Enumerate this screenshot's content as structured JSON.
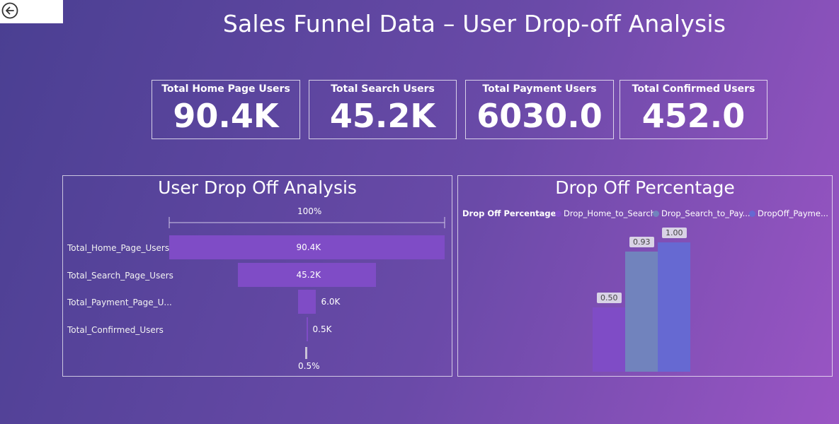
{
  "page": {
    "title": "Sales Funnel Data – User Drop-off Analysis"
  },
  "kpis": [
    {
      "label": "Total Home Page Users",
      "value": "90.4K"
    },
    {
      "label": "Total Search Users",
      "value": "45.2K"
    },
    {
      "label": "Total Payment Users",
      "value": "6030.0"
    },
    {
      "label": "Total Confirmed Users",
      "value": "452.0"
    }
  ],
  "chart_data": [
    {
      "type": "bar",
      "subtype": "funnel",
      "title": "User Drop Off Analysis",
      "top_label": "100%",
      "bottom_label": "0.5%",
      "categories": [
        "Total_Home_Page_Users",
        "Total_Search_Page_Users",
        "Total_Payment_Page_U...",
        "Total_Confirmed_Users"
      ],
      "values": [
        90400,
        45200,
        6030,
        452
      ],
      "value_labels": [
        "90.4K",
        "45.2K",
        "6.0K",
        "0.5K"
      ],
      "bar_color": "#7f4cc6"
    },
    {
      "type": "bar",
      "title": "Drop Off Percentage",
      "legend_title": "Drop Off Percentage",
      "legend_position": "top-left",
      "series": [
        {
          "name": "Drop_Home_to_Search",
          "values": [
            0.5
          ],
          "label": "0.50",
          "color": "#7f4cc6"
        },
        {
          "name": "Drop_Search_to_Pay...",
          "values": [
            0.93
          ],
          "label": "0.93",
          "color": "#7183bd"
        },
        {
          "name": "DropOff_Payme...",
          "values": [
            1.0
          ],
          "label": "1.00",
          "color": "#6669d2"
        }
      ],
      "ylim": [
        0,
        1.0
      ]
    }
  ]
}
